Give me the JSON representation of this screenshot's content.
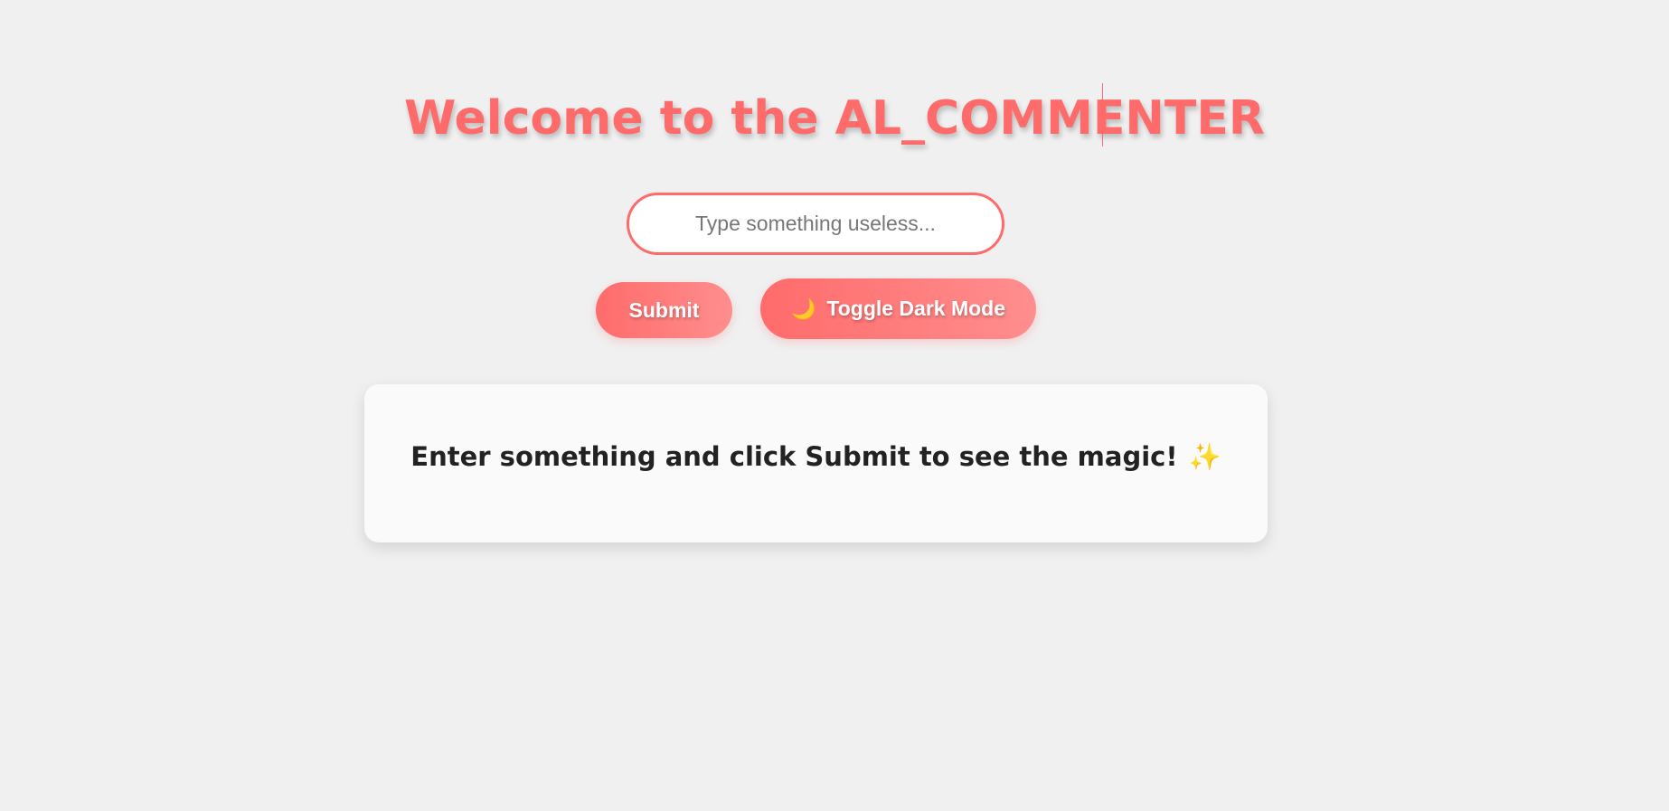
{
  "header": {
    "title": "Welcome to the AL_COMMENTER"
  },
  "input": {
    "placeholder": "Type something useless...",
    "value": ""
  },
  "buttons": {
    "submit_label": "Submit",
    "toggle_icon": "🌙",
    "toggle_label": "Toggle Dark Mode"
  },
  "result": {
    "message": "Enter something and click Submit to see the magic!",
    "icon": "✨"
  },
  "colors": {
    "accent": "#ff6b6b",
    "background": "#f0f0f0",
    "card": "#fafafa",
    "text": "#222222"
  }
}
